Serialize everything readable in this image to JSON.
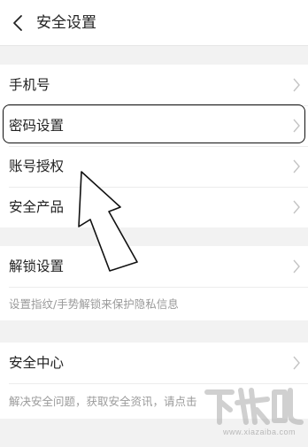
{
  "header": {
    "back_icon": "chevron-left-icon",
    "title": "安全设置"
  },
  "groups": [
    {
      "items": [
        {
          "label": "手机号"
        },
        {
          "label": "密码设置"
        },
        {
          "label": "账号授权"
        },
        {
          "label": "安全产品"
        }
      ]
    },
    {
      "items": [
        {
          "label": "解锁设置"
        }
      ],
      "caption": "设置指纹/手势解锁来保护隐私信息"
    },
    {
      "items": [
        {
          "label": "安全中心"
        }
      ],
      "caption": "解决安全问题，获取安全资讯，请点击"
    }
  ],
  "annotation": {
    "highlight_color": "#111111",
    "arrow_icon": "arrow-up-annotation-icon"
  },
  "watermark": {
    "logo_text": "下载吧",
    "url": "www.xiazaiba.com"
  }
}
